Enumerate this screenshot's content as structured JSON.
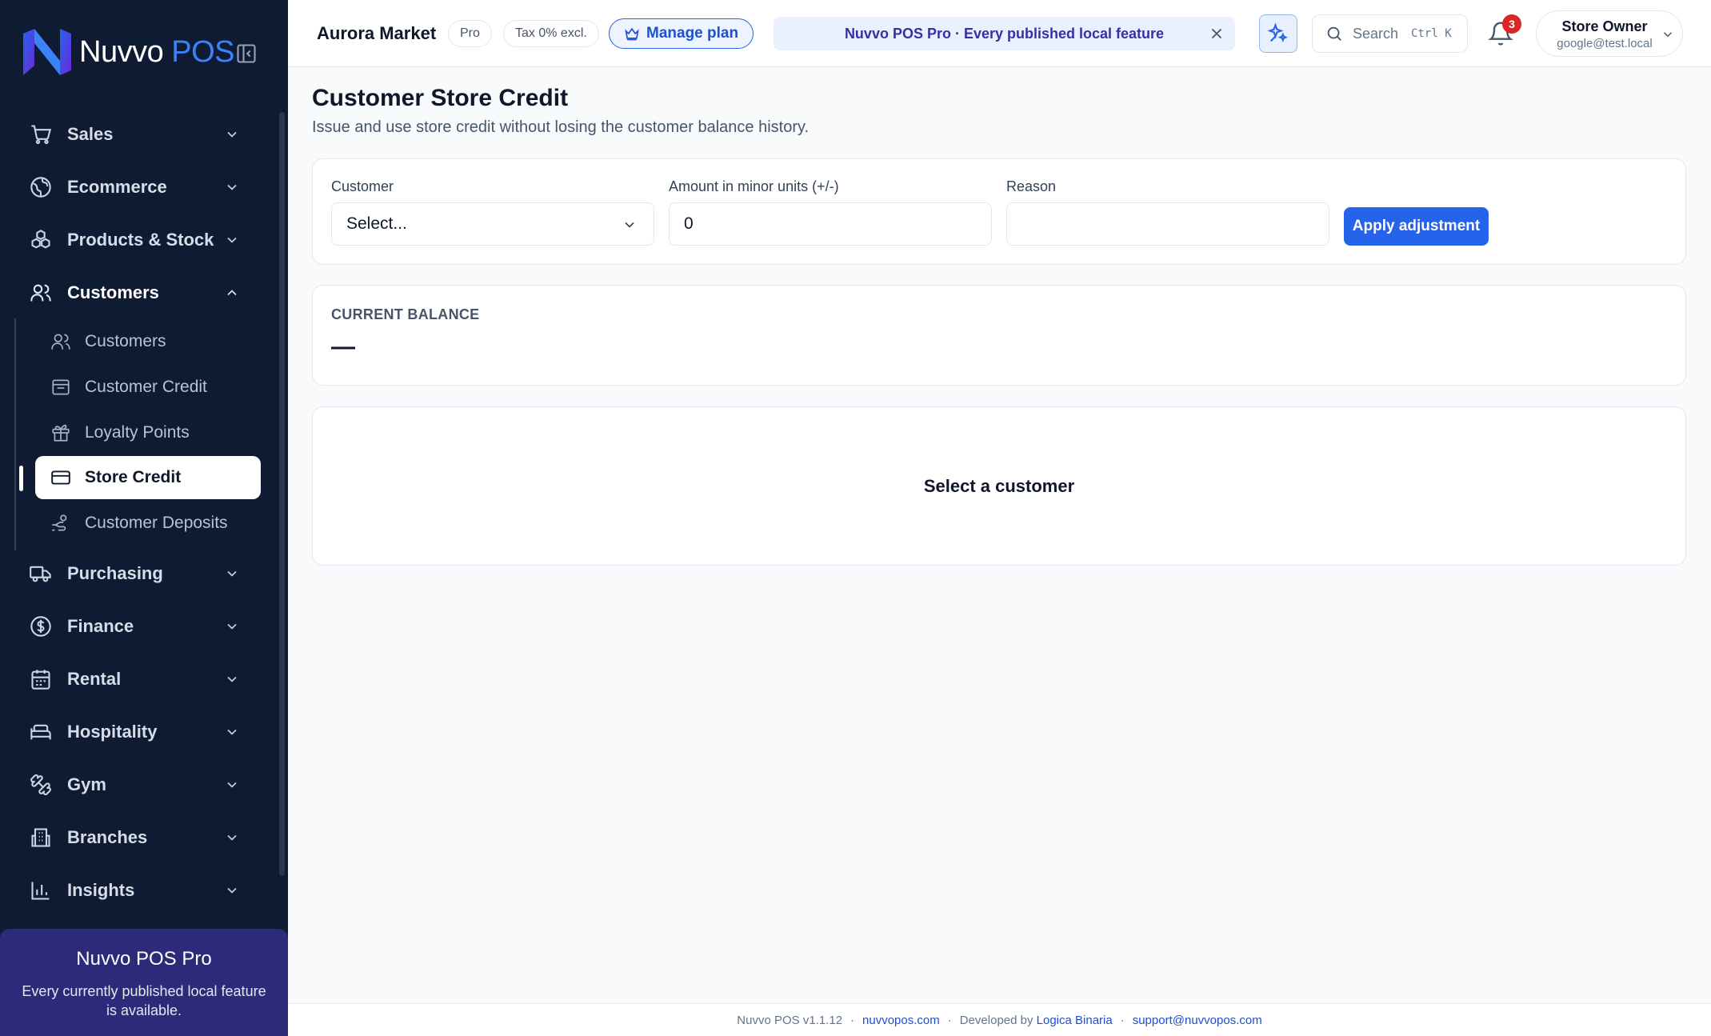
{
  "brand": {
    "name_part1": "Nuvvo",
    "name_part2": "POS"
  },
  "sidebar": {
    "nav": [
      {
        "label": "Sales",
        "icon": "cart-icon"
      },
      {
        "label": "Ecommerce",
        "icon": "globe-icon"
      },
      {
        "label": "Products & Stock",
        "icon": "boxes-icon"
      },
      {
        "label": "Customers",
        "icon": "users-icon"
      },
      {
        "label": "Purchasing",
        "icon": "truck-icon"
      },
      {
        "label": "Finance",
        "icon": "dollar-icon"
      },
      {
        "label": "Rental",
        "icon": "calendar-icon"
      },
      {
        "label": "Hospitality",
        "icon": "bed-icon"
      },
      {
        "label": "Gym",
        "icon": "dumbbell-icon"
      },
      {
        "label": "Branches",
        "icon": "building-icon"
      },
      {
        "label": "Insights",
        "icon": "bar-chart-icon"
      }
    ],
    "customers_sub": [
      {
        "label": "Customers",
        "icon": "users-icon"
      },
      {
        "label": "Customer Credit",
        "icon": "wallet-icon"
      },
      {
        "label": "Loyalty Points",
        "icon": "gift-icon"
      },
      {
        "label": "Store Credit",
        "icon": "credit-card-icon"
      },
      {
        "label": "Customer Deposits",
        "icon": "hand-coins-icon"
      }
    ],
    "promo": {
      "title": "Nuvvo POS Pro",
      "text": "Every currently published local feature is available."
    }
  },
  "header": {
    "store_name": "Aurora Market",
    "plan_pill": "Pro",
    "tax_pill": "Tax 0% excl.",
    "manage_plan": "Manage plan",
    "banner": "Nuvvo POS Pro · Every published local feature",
    "search_placeholder": "Search",
    "search_shortcut": "Ctrl K",
    "notification_count": "3",
    "user_name": "Store Owner",
    "user_email": "google@test.local"
  },
  "main": {
    "title": "Customer Store Credit",
    "subtitle": "Issue and use store credit without losing the customer balance history.",
    "form": {
      "customer_label": "Customer",
      "customer_value": "Select...",
      "amount_label": "Amount in minor units (+/-)",
      "amount_value": "0",
      "reason_label": "Reason",
      "reason_value": "",
      "apply_label": "Apply adjustment"
    },
    "balance": {
      "label": "CURRENT BALANCE",
      "value": "—"
    },
    "empty_state": "Select a customer"
  },
  "footer": {
    "version": "Nuvvo POS v1.1.12",
    "site": "nuvvopos.com",
    "developed_by": "Developed by",
    "developer": "Logica Binaria",
    "support": "support@nuvvopos.com"
  },
  "colors": {
    "sidebar_bg": "#0f1a33",
    "accent": "#2563eb",
    "promo_bg": "#2d2a7a",
    "badge": "#dc2626"
  }
}
